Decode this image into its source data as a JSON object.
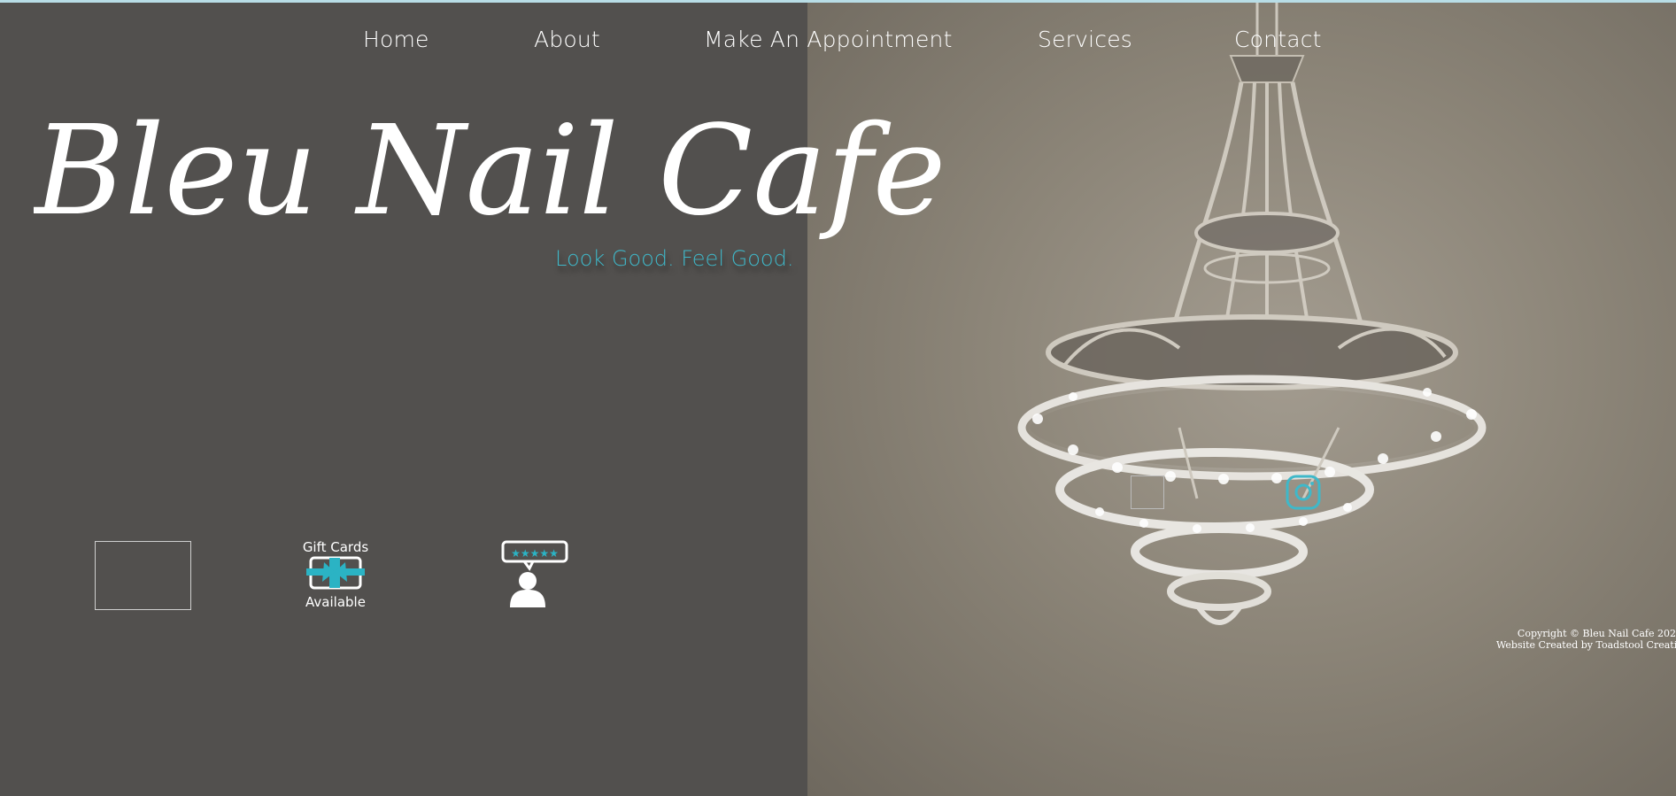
{
  "nav": {
    "items": [
      {
        "label": "Home"
      },
      {
        "label": "About"
      },
      {
        "label": "Make An Appointment"
      },
      {
        "label": "Services"
      },
      {
        "label": "Contact"
      }
    ]
  },
  "hero": {
    "logo_text": "Bleu Nail Cafe",
    "tagline": "Look Good. Feel Good."
  },
  "badges": {
    "gift_card_top": "Gift Cards",
    "gift_card_bottom": "Available",
    "review_stars": "★★★★★"
  },
  "social": {
    "icons": [
      "broken-image-icon",
      "instagram-icon"
    ]
  },
  "footer": {
    "copyright": "Copyright © Bleu Nail Cafe 202",
    "credit": "Website Created by Toadstool Creative Grou"
  },
  "colors": {
    "background": "#52504e",
    "accent": "#3fb8c9",
    "text": "#ffffff",
    "top_strip": "#b8dde6"
  }
}
